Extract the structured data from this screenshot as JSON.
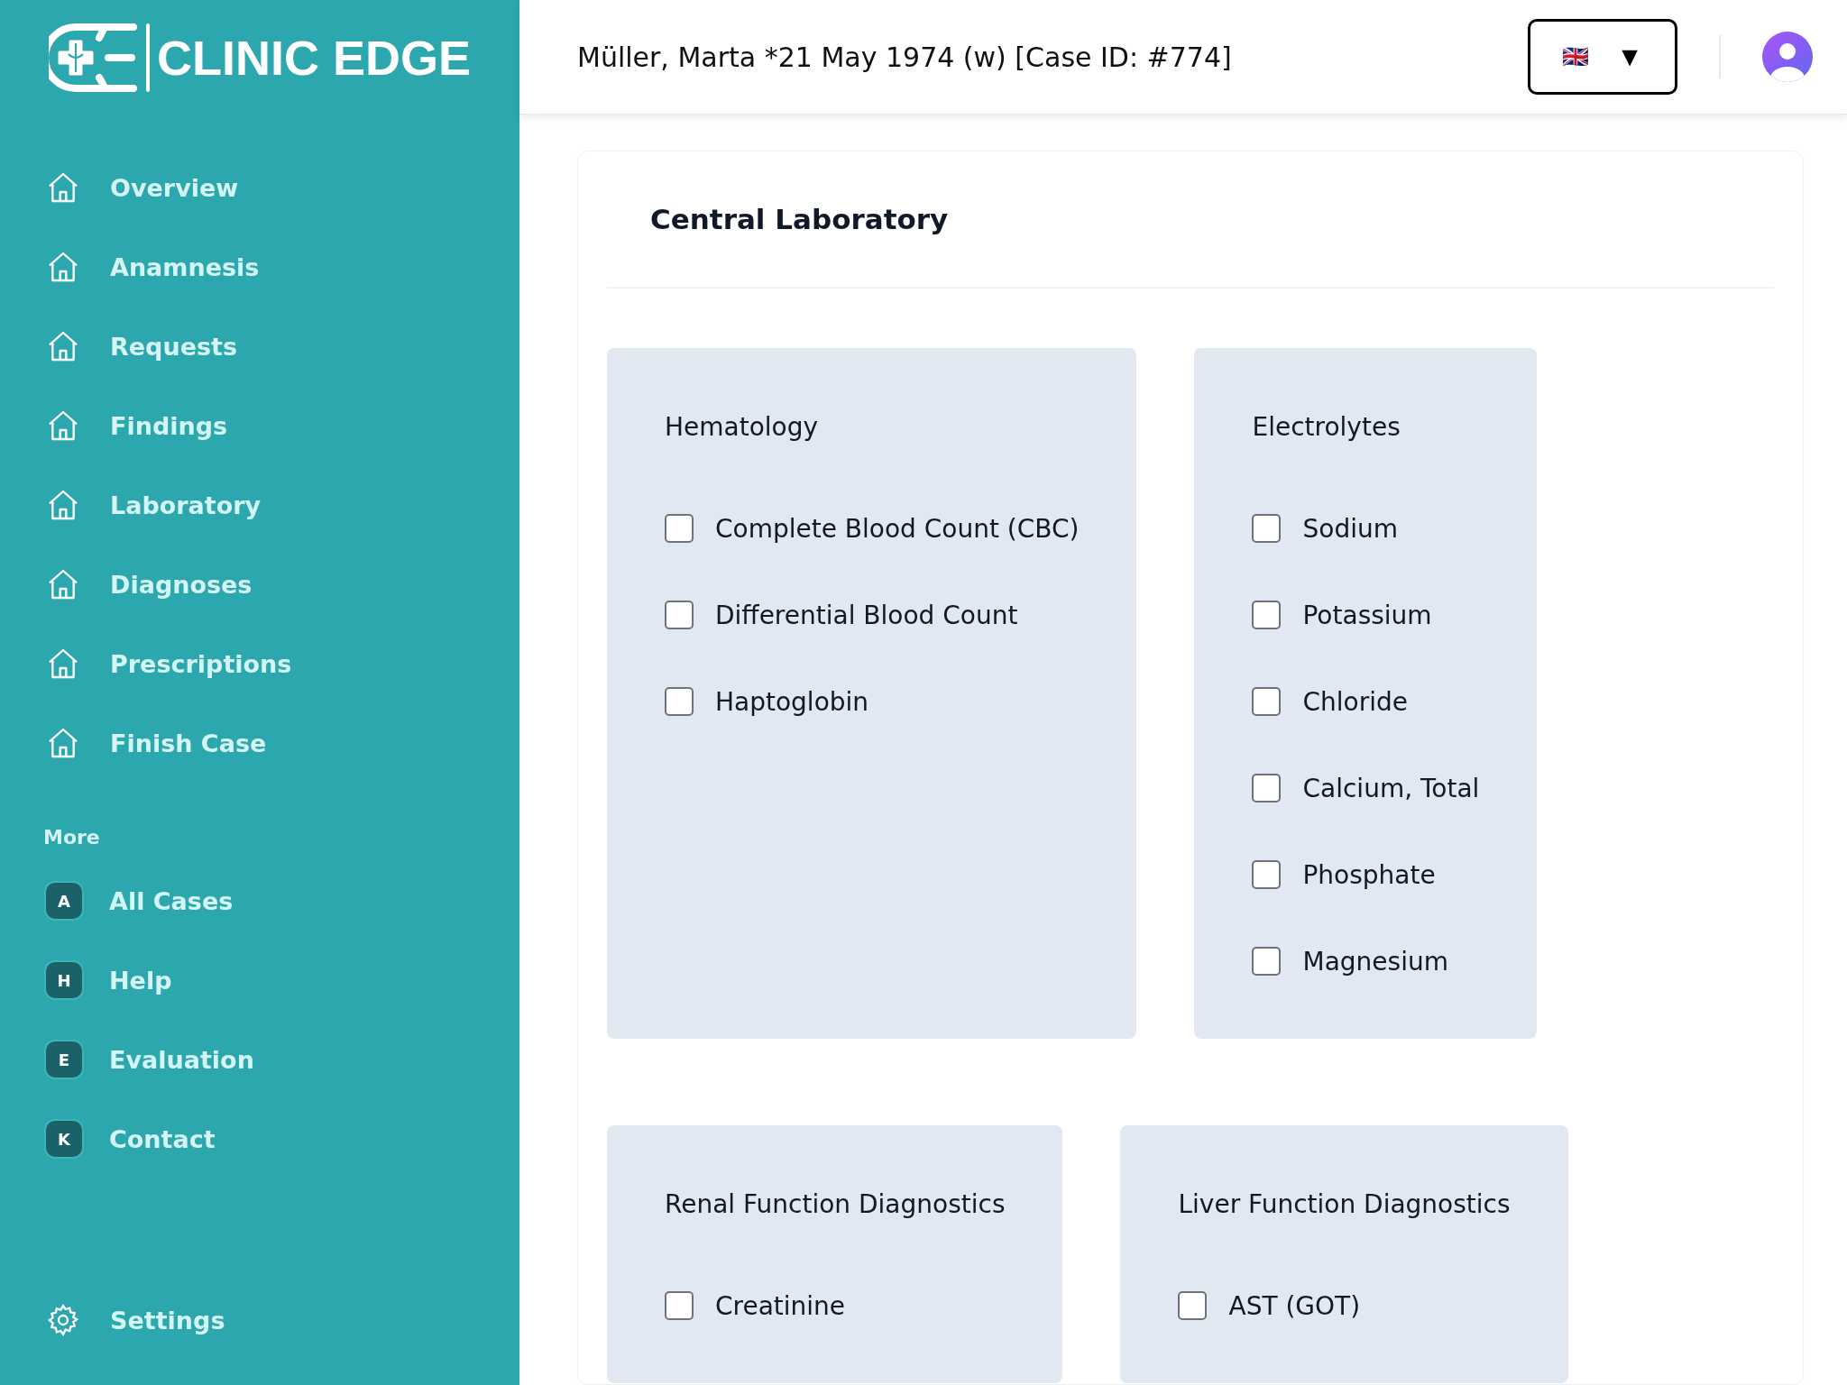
{
  "sidebar": {
    "logo_text": "CLINIC EDGE",
    "nav_items": [
      {
        "label": "Overview"
      },
      {
        "label": "Anamnesis"
      },
      {
        "label": "Requests"
      },
      {
        "label": "Findings"
      },
      {
        "label": "Laboratory"
      },
      {
        "label": "Diagnoses"
      },
      {
        "label": "Prescriptions"
      },
      {
        "label": "Finish Case"
      }
    ],
    "more_heading": "More",
    "more_items": [
      {
        "badge": "A",
        "label": "All Cases"
      },
      {
        "badge": "H",
        "label": "Help"
      },
      {
        "badge": "E",
        "label": "Evaluation"
      },
      {
        "badge": "K",
        "label": "Contact"
      }
    ],
    "settings": {
      "label": "Settings"
    }
  },
  "header": {
    "patient": "Müller, Marta *21 May 1974 (w) [Case ID: #774]",
    "language_button": {
      "flag": "🇬🇧",
      "caret": "▼"
    }
  },
  "panel": {
    "title": "Central Laboratory",
    "rows": [
      [
        {
          "title": "Hematology",
          "items": [
            {
              "label": "Complete Blood Count (CBC)",
              "checked": false
            },
            {
              "label": "Differential Blood Count",
              "checked": false
            },
            {
              "label": "Haptoglobin",
              "checked": false
            }
          ]
        },
        {
          "title": "Electrolytes",
          "items": [
            {
              "label": "Sodium",
              "checked": false
            },
            {
              "label": "Potassium",
              "checked": false
            },
            {
              "label": "Chloride",
              "checked": false
            },
            {
              "label": "Calcium, Total",
              "checked": false
            },
            {
              "label": "Phosphate",
              "checked": false
            },
            {
              "label": "Magnesium",
              "checked": false
            }
          ]
        }
      ],
      [
        {
          "title": "Renal Function Diagnostics",
          "items": [
            {
              "label": "Creatinine",
              "checked": false
            }
          ]
        },
        {
          "title": "Liver Function Diagnostics",
          "items": [
            {
              "label": "AST (GOT)",
              "checked": false
            }
          ]
        }
      ]
    ]
  }
}
